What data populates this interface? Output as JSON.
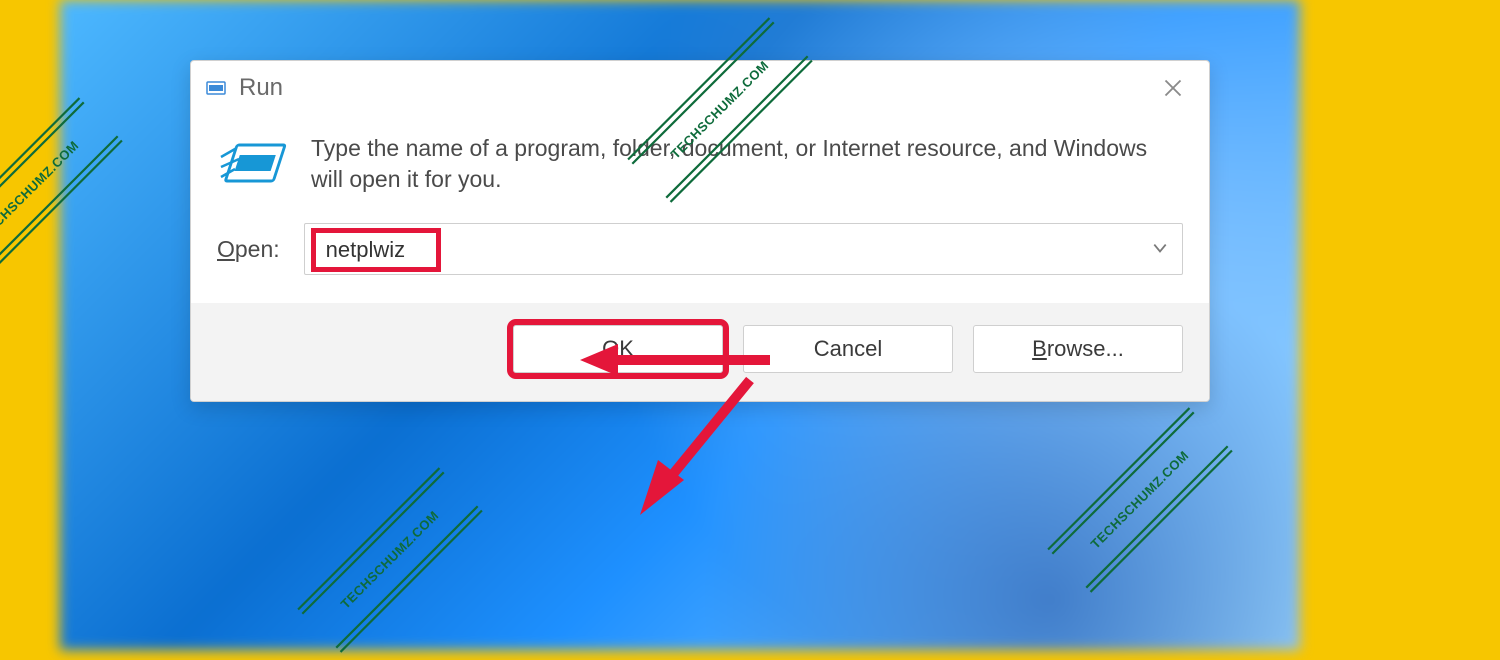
{
  "watermark": {
    "text": "TECHSCHUMZ.COM"
  },
  "dialog": {
    "title": "Run",
    "description": "Type the name of a program, folder, document, or Internet resource, and Windows will open it for you.",
    "open_label_key": "O",
    "open_label_rest": "pen:",
    "input_value": "netplwiz",
    "buttons": {
      "ok": "OK",
      "cancel": "Cancel",
      "browse_key": "B",
      "browse_rest": "rowse..."
    }
  },
  "colors": {
    "highlight": "#e4163a",
    "accent_yellow": "#f7c600",
    "watermark_green": "#0e6b3b"
  }
}
